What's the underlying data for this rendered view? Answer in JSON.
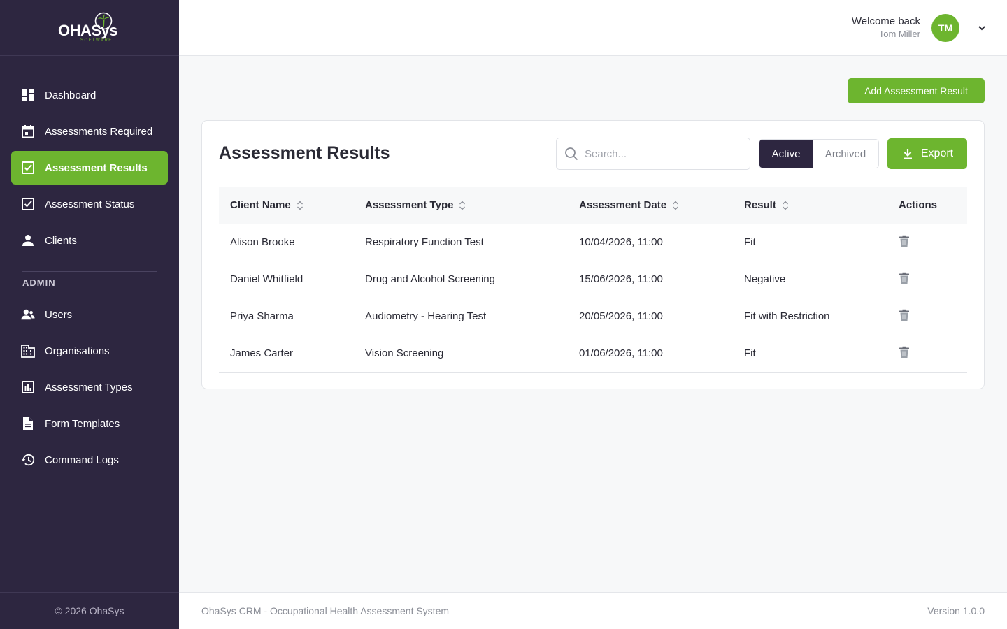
{
  "brand": {
    "logo_text": "OHASys",
    "logo_sub": "SOFTWARE",
    "accent": "#6db52f",
    "sidebar_bg": "#2d2640"
  },
  "sidebar": {
    "items": [
      {
        "label": "Dashboard",
        "icon": "dashboard-icon"
      },
      {
        "label": "Assessments Required",
        "icon": "calendar-icon"
      },
      {
        "label": "Assessment Results",
        "icon": "checkbox-icon",
        "active": true
      },
      {
        "label": "Assessment Status",
        "icon": "checkbox-icon"
      },
      {
        "label": "Clients",
        "icon": "person-icon"
      }
    ],
    "admin_label": "ADMIN",
    "admin_items": [
      {
        "label": "Users",
        "icon": "users-icon"
      },
      {
        "label": "Organisations",
        "icon": "building-icon"
      },
      {
        "label": "Assessment Types",
        "icon": "bar-chart-icon"
      },
      {
        "label": "Form Templates",
        "icon": "document-icon"
      },
      {
        "label": "Command Logs",
        "icon": "history-icon"
      }
    ],
    "footer": "© 2026 OhaSys"
  },
  "header": {
    "welcome": "Welcome back",
    "user_name": "Tom Miller",
    "avatar_initials": "TM"
  },
  "main": {
    "add_button": "Add Assessment Result",
    "title": "Assessment Results",
    "search_placeholder": "Search...",
    "filter": {
      "active": "Active",
      "archived": "Archived",
      "selected": "Active"
    },
    "export_label": "Export",
    "table": {
      "columns": [
        "Client Name",
        "Assessment Type",
        "Assessment Date",
        "Result",
        "Actions"
      ],
      "rows": [
        {
          "client": "Alison Brooke",
          "type": "Respiratory Function Test",
          "date": "10/04/2026, 11:00",
          "result": "Fit"
        },
        {
          "client": "Daniel Whitfield",
          "type": "Drug and Alcohol Screening",
          "date": "15/06/2026, 11:00",
          "result": "Negative"
        },
        {
          "client": "Priya Sharma",
          "type": "Audiometry - Hearing Test",
          "date": "20/05/2026, 11:00",
          "result": "Fit with Restriction"
        },
        {
          "client": "James Carter",
          "type": "Vision Screening",
          "date": "01/06/2026, 11:00",
          "result": "Fit"
        }
      ]
    }
  },
  "footer": {
    "left": "OhaSys CRM - Occupational Health Assessment System",
    "right": "Version 1.0.0"
  }
}
